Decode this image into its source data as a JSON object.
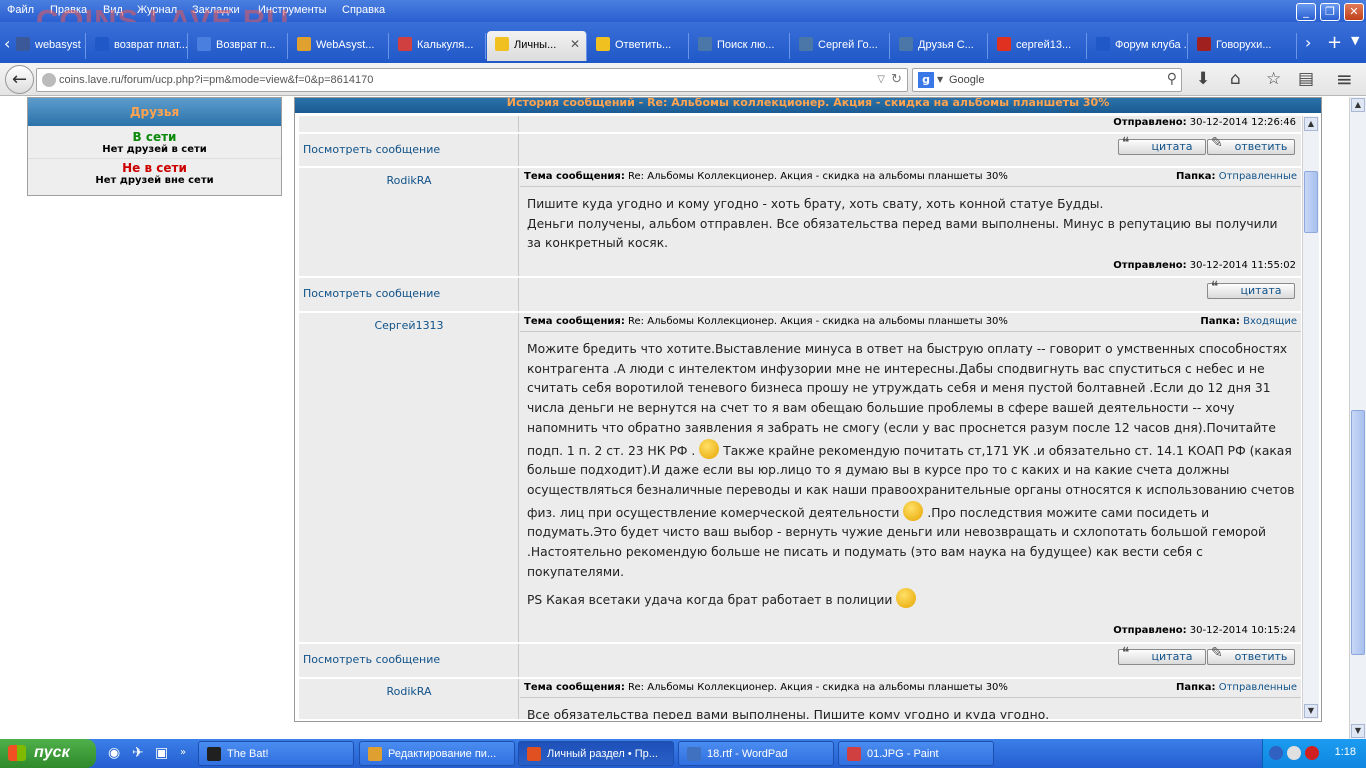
{
  "watermark": "COINS.LAVE.RU",
  "menu": [
    "Файл",
    "Правка",
    "Вид",
    "Журнал",
    "Закладки",
    "Инструменты",
    "Справка"
  ],
  "window_controls": {
    "minimize": "_",
    "maximize": "❐",
    "close": "✕"
  },
  "tabs": [
    {
      "label": "webasyst ...",
      "icon_color": "#3b5998"
    },
    {
      "label": "возврат плат...",
      "icon_color": "#2058c8"
    },
    {
      "label": "Возврат п...",
      "icon_color": "#4a7fe0"
    },
    {
      "label": "WebAsyst...",
      "icon_color": "#e0a030"
    },
    {
      "label": "Калькуля...",
      "icon_color": "#d04040"
    },
    {
      "label": "Личны...",
      "icon_color": "#f0c020",
      "active": true
    },
    {
      "label": "Ответить...",
      "icon_color": "#f0c020"
    },
    {
      "label": "Поиск лю...",
      "icon_color": "#4a76a8"
    },
    {
      "label": "Сергей Го...",
      "icon_color": "#4a76a8"
    },
    {
      "label": "Друзья С...",
      "icon_color": "#4a76a8"
    },
    {
      "label": "сергей13...",
      "icon_color": "#e03020"
    },
    {
      "label": "Форум клуба ...",
      "icon_color": "#2058c8"
    },
    {
      "label": "Говорухи...",
      "icon_color": "#a02020"
    }
  ],
  "address": {
    "url": "coins.lave.ru/forum/ucp.php?i=pm&mode=view&f=0&p=8614170"
  },
  "search": {
    "placeholder": "Google",
    "engine_letter": "g"
  },
  "friends": {
    "title": "Друзья",
    "online_label": "В сети",
    "online_none": "Нет друзей в сети",
    "offline_label": "Не в сети",
    "offline_none": "Нет друзей вне сети"
  },
  "history_title": "История сообщений - Re: Альбомы коллекционер. Акция - скидка на альбомы планшеты 30%",
  "labels": {
    "subject": "Тема сообщения:",
    "folder": "Папка:",
    "sent": "Отправлено:",
    "view_message": "Посмотреть сообщение",
    "quote": "цитата",
    "reply": "ответить"
  },
  "first_sent": "30-12-2014 12:26:46",
  "messages": [
    {
      "author": "RodikRA",
      "subject": "Re: Альбомы Коллекционер. Акция - скидка на альбомы планшеты 30%",
      "folder": "Отправленные",
      "lines": [
        "Пишите куда угодно и кому угодно - хоть брату, хоть свату, хоть конной статуе Будды.",
        "Деньги получены, альбом отправлен. Все обязательства перед вами выполнены. Минус в репутацию вы получили",
        "за конкретный косяк."
      ],
      "sent": "30-12-2014 11:55:02"
    },
    {
      "author": "Сергей1313",
      "subject": "Re: Альбомы Коллекционер. Акция - скидка на альбомы планшеты 30%",
      "folder": "Входящие",
      "p1": "Можите бредить что хотите.Выставление минуса в ответ на быструю оплату -- говорит о умственных способностях контрагента .А люди с интелектом инфузории мне не интересны.Дабы сподвигнуть вас спуститься с небес и не считать себя воротилой теневого бизнеса прошу не утруждать себя и меня пустой болтавней .Если до 12 дня 31 числа деньги не вернутся на счет то я вам обещаю большие проблемы в сфере вашей деятельности -- хочу напомнить что обратно заявления я забрать не смогу (если у вас проснется разум после 12 часов дня).Почитайте подп. 1 п. 2 ст. 23 НК РФ .",
      "p2": "Также крайне рекомендую почитать ст,171 УК .и обязательно ст. 14.1 КОАП РФ (какая больше подходит).И даже если вы юр.лицо то я думаю вы в курсе про то с каких и на какие счета должны осуществляться безналичные переводы и как наши правоохранительные органы относятся к использованию счетов физ. лиц при осуществление комерческой деятельности",
      "p3": ".Про последствия можите сами посидеть и подумать.Это будет чисто ваш выбор - вернуть чужие деньги или невозвращать и схлопотать большой геморой .Настоятельно рекомендую больше не писать и подумать (это вам наука на будущее) как вести себя с покупателями.",
      "ps": "PS Какая всетаки удача когда брат работает в полиции",
      "sent": "30-12-2014 10:15:24"
    },
    {
      "author": "RodikRA",
      "subject": "Re: Альбомы Коллекционер. Акция - скидка на альбомы планшеты 30%",
      "folder": "Отправленные",
      "line": "Все обязательства перед вами выполнены. Пишите кому угодно и куда угодно."
    }
  ],
  "taskbar": {
    "start": "пуск",
    "tasks": [
      {
        "label": "The Bat!",
        "icon_color": "#202020"
      },
      {
        "label": "Редактирование пи...",
        "icon_color": "#e0a030"
      },
      {
        "label": "Личный раздел • Пр...",
        "icon_color": "#e05020",
        "active": true
      },
      {
        "label": "18.rtf - WordPad",
        "icon_color": "#4070c0"
      },
      {
        "label": "01.JPG - Paint",
        "icon_color": "#d04040"
      }
    ],
    "clock": "1:18"
  }
}
